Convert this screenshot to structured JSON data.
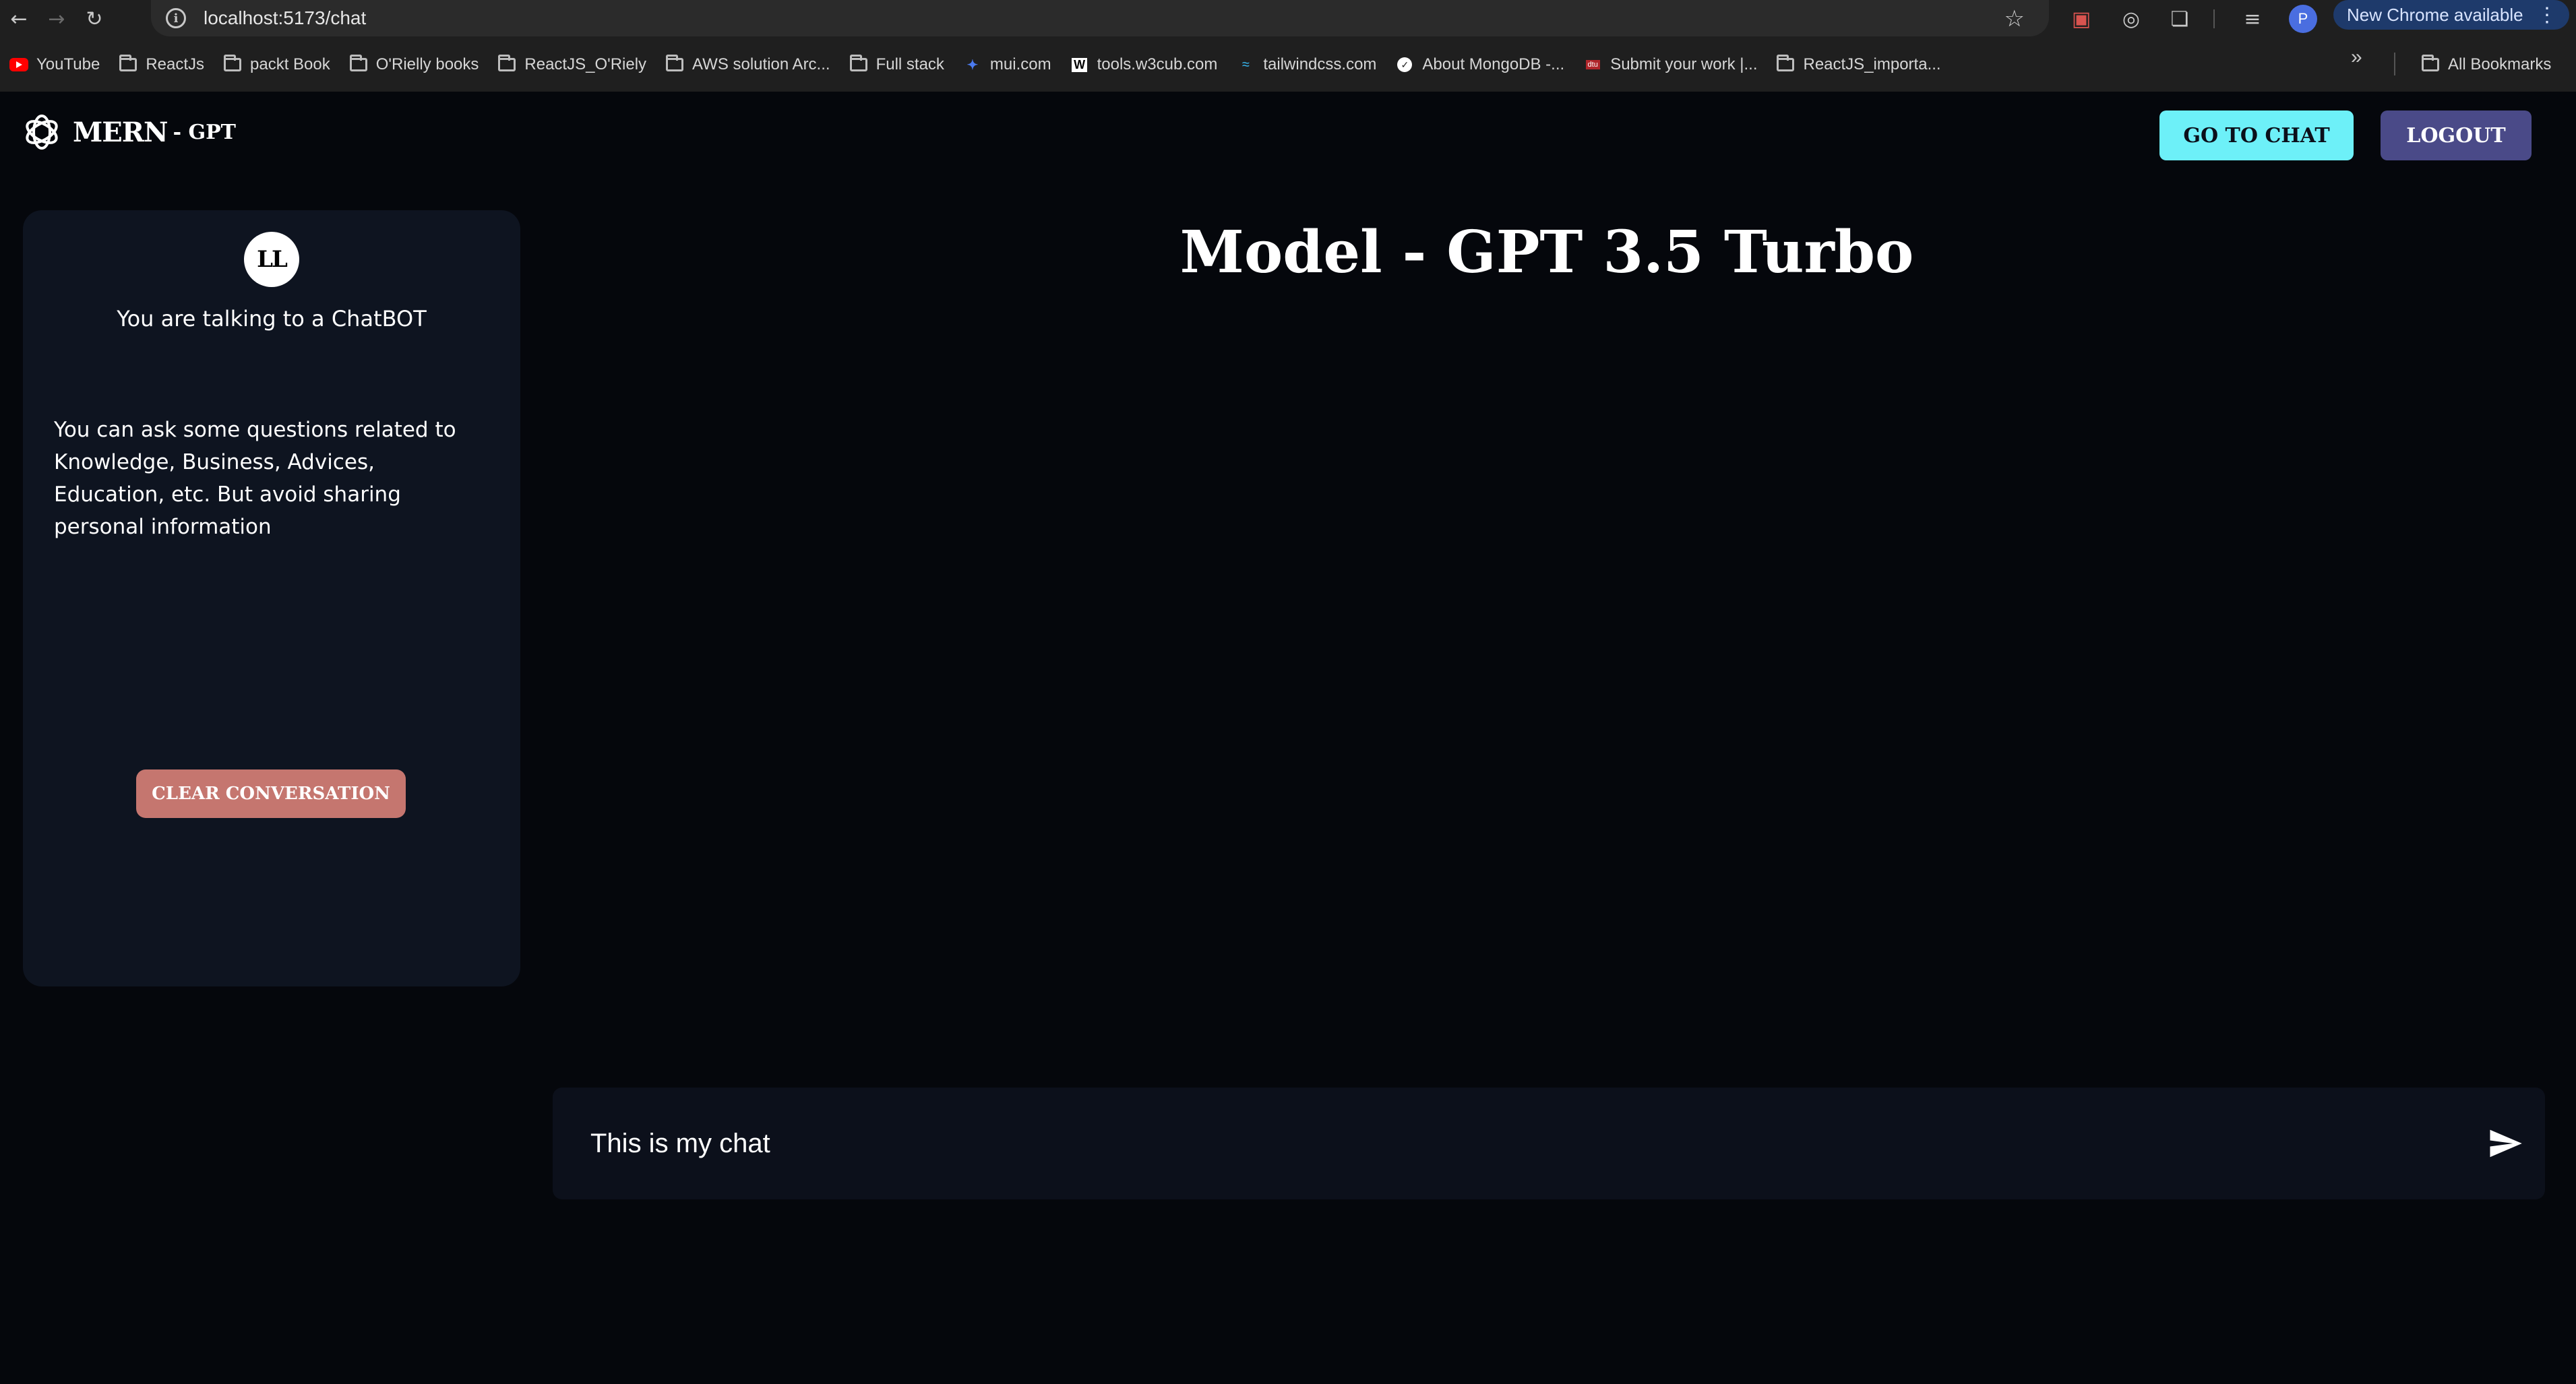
{
  "browser": {
    "url": "localhost:5173/chat",
    "update_label": "New Chrome available",
    "profile_initial": "P"
  },
  "bookmarks": [
    {
      "label": "YouTube",
      "icon": "youtube-icon"
    },
    {
      "label": "ReactJs",
      "icon": "folder-icon"
    },
    {
      "label": "packt Book",
      "icon": "folder-icon"
    },
    {
      "label": "O'Rielly books",
      "icon": "folder-icon"
    },
    {
      "label": "ReactJS_O'Riely",
      "icon": "folder-icon"
    },
    {
      "label": "AWS solution Arc...",
      "icon": "folder-icon"
    },
    {
      "label": "Full stack",
      "icon": "folder-icon"
    },
    {
      "label": "mui.com",
      "icon": "mui-icon"
    },
    {
      "label": "tools.w3cub.com",
      "icon": "w3cub-icon"
    },
    {
      "label": "tailwindcss.com",
      "icon": "tailwind-icon"
    },
    {
      "label": "About MongoDB -...",
      "icon": "mongodb-icon"
    },
    {
      "label": "Submit your work |...",
      "icon": "site-icon"
    },
    {
      "label": "ReactJS_importa...",
      "icon": "folder-icon"
    }
  ],
  "all_bookmarks_label": "All Bookmarks",
  "header": {
    "brand": "MERN",
    "brand_suffix": "- GPT",
    "go_to_chat": "GO TO CHAT",
    "logout": "LOGOUT"
  },
  "sidebar": {
    "avatar_initials": "LL",
    "title": "You are talking to a ChatBOT",
    "description": "You can ask some questions related to Knowledge, Business, Advices, Education, etc. But avoid sharing personal information",
    "clear_button": "CLEAR CONVERSATION"
  },
  "main": {
    "title": "Model - GPT 3.5 Turbo",
    "input_value": "This is my chat"
  },
  "colors": {
    "background": "#05070c",
    "sidebar_bg": "#0e1420",
    "go_to_chat_bg": "#6df0f8",
    "logout_bg": "#4a4a88",
    "clear_bg": "#c5766f"
  }
}
